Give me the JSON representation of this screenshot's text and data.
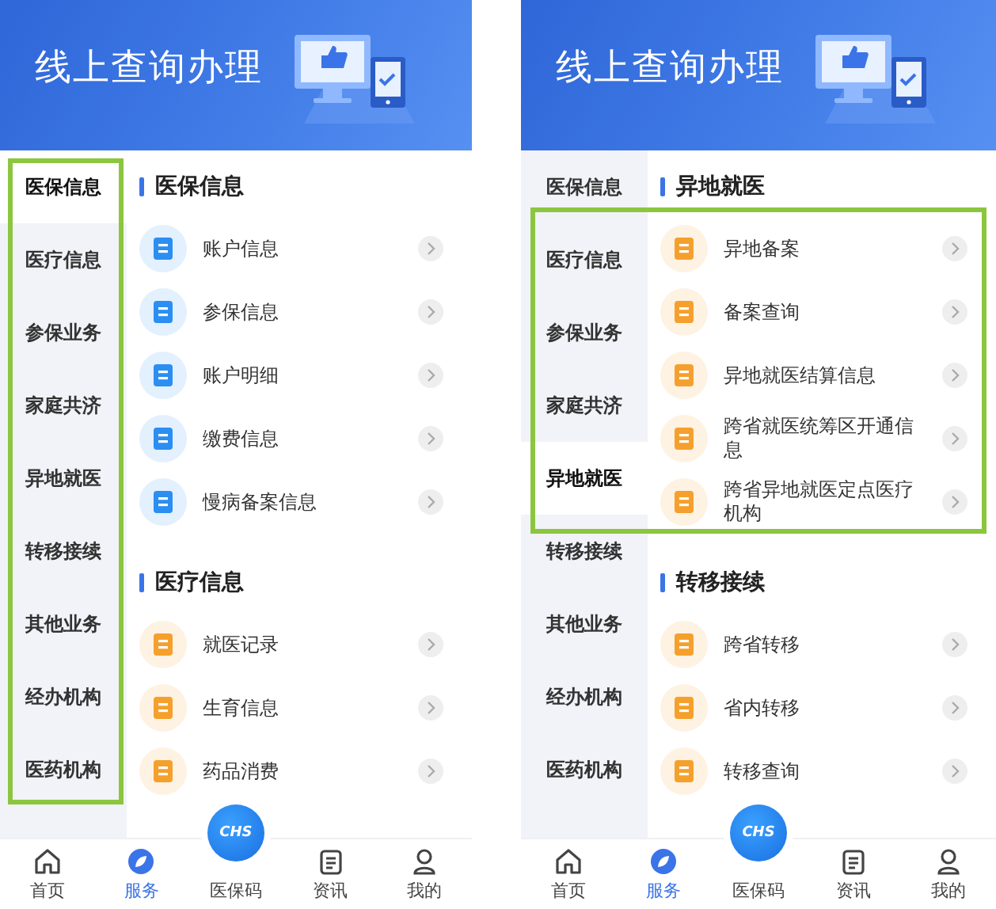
{
  "phones": [
    {
      "header": {
        "title": "线上查询办理"
      },
      "highlight": {
        "kind": "sidebar"
      },
      "sidebar": [
        {
          "label": "医保信息",
          "selected": true
        },
        {
          "label": "医疗信息",
          "selected": false
        },
        {
          "label": "参保业务",
          "selected": false
        },
        {
          "label": "家庭共济",
          "selected": false
        },
        {
          "label": "异地就医",
          "selected": false
        },
        {
          "label": "转移接续",
          "selected": false
        },
        {
          "label": "其他业务",
          "selected": false
        },
        {
          "label": "经办机构",
          "selected": false
        },
        {
          "label": "医药机构",
          "selected": false
        }
      ],
      "sections": [
        {
          "title": "医保信息",
          "color": "#2b8ef2",
          "items": [
            {
              "label": "账户信息"
            },
            {
              "label": "参保信息"
            },
            {
              "label": "账户明细"
            },
            {
              "label": "缴费信息"
            },
            {
              "label": "慢病备案信息"
            }
          ]
        },
        {
          "title": "医疗信息",
          "color": "#f5a02c",
          "items": [
            {
              "label": "就医记录"
            },
            {
              "label": "生育信息"
            },
            {
              "label": "药品消费"
            }
          ]
        }
      ],
      "tabbar": [
        {
          "kind": "home",
          "label": "首页",
          "selected": false
        },
        {
          "kind": "service",
          "label": "服务",
          "selected": true
        },
        {
          "kind": "code",
          "label": "医保码",
          "badge": "CHS",
          "selected": false
        },
        {
          "kind": "news",
          "label": "资讯",
          "selected": false
        },
        {
          "kind": "profile",
          "label": "我的",
          "selected": false
        }
      ]
    },
    {
      "header": {
        "title": "线上查询办理"
      },
      "highlight": {
        "kind": "section"
      },
      "sidebar": [
        {
          "label": "医保信息",
          "selected": false
        },
        {
          "label": "医疗信息",
          "selected": false
        },
        {
          "label": "参保业务",
          "selected": false
        },
        {
          "label": "家庭共济",
          "selected": false
        },
        {
          "label": "异地就医",
          "selected": true
        },
        {
          "label": "转移接续",
          "selected": false
        },
        {
          "label": "其他业务",
          "selected": false
        },
        {
          "label": "经办机构",
          "selected": false
        },
        {
          "label": "医药机构",
          "selected": false
        }
      ],
      "sections": [
        {
          "title": "异地就医",
          "color": "#f5a02c",
          "items": [
            {
              "label": "异地备案"
            },
            {
              "label": "备案查询"
            },
            {
              "label": "异地就医结算信息"
            },
            {
              "label": "跨省就医统筹区开通信息"
            },
            {
              "label": "跨省异地就医定点医疗机构"
            }
          ]
        },
        {
          "title": "转移接续",
          "color": "#f5a02c",
          "items": [
            {
              "label": "跨省转移"
            },
            {
              "label": "省内转移"
            },
            {
              "label": "转移查询"
            }
          ]
        }
      ],
      "tabbar": [
        {
          "kind": "home",
          "label": "首页",
          "selected": false
        },
        {
          "kind": "service",
          "label": "服务",
          "selected": true
        },
        {
          "kind": "code",
          "label": "医保码",
          "badge": "CHS",
          "selected": false
        },
        {
          "kind": "news",
          "label": "资讯",
          "selected": false
        },
        {
          "kind": "profile",
          "label": "我的",
          "selected": false
        }
      ]
    }
  ]
}
